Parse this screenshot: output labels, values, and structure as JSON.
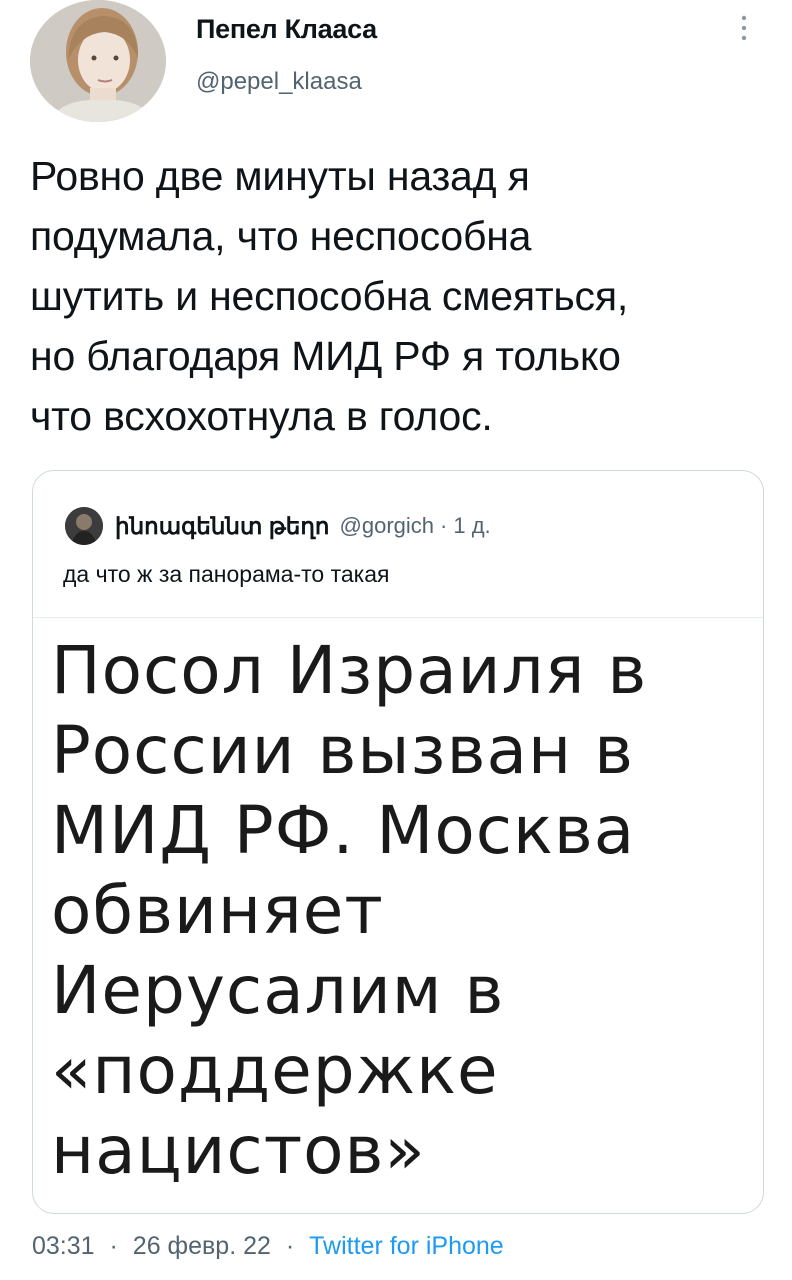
{
  "author": {
    "name": "Пепел Клааса",
    "handle": "@pepel_klaasa",
    "avatar_icon": "avatar-photo"
  },
  "tweet": {
    "text": "Ровно две минуты назад я\nподумала, что неспособна\nшутить и неспособна смеяться,\nно благодаря МИД РФ я только\nчто всхохотнула в голос."
  },
  "quote": {
    "name": "ինոագեննտ թեղո",
    "handle": "@gorgich",
    "separator": "·",
    "time": "1 д.",
    "text": "да что ж за панорама-то такая",
    "headline": "Посол Израиля в\nРоссии вызван в\nМИД РФ. Москва\nобвиняет\nИерусалим в\n«поддержке\nнацистов»"
  },
  "footer": {
    "time": "03:31",
    "sep1": "·",
    "date": "26 февр. 22",
    "sep2": "·",
    "source": "Twitter for iPhone"
  },
  "colors": {
    "text": "#0f1419",
    "secondary": "#536471",
    "link": "#1d9bf0",
    "border": "#cfd9de"
  }
}
